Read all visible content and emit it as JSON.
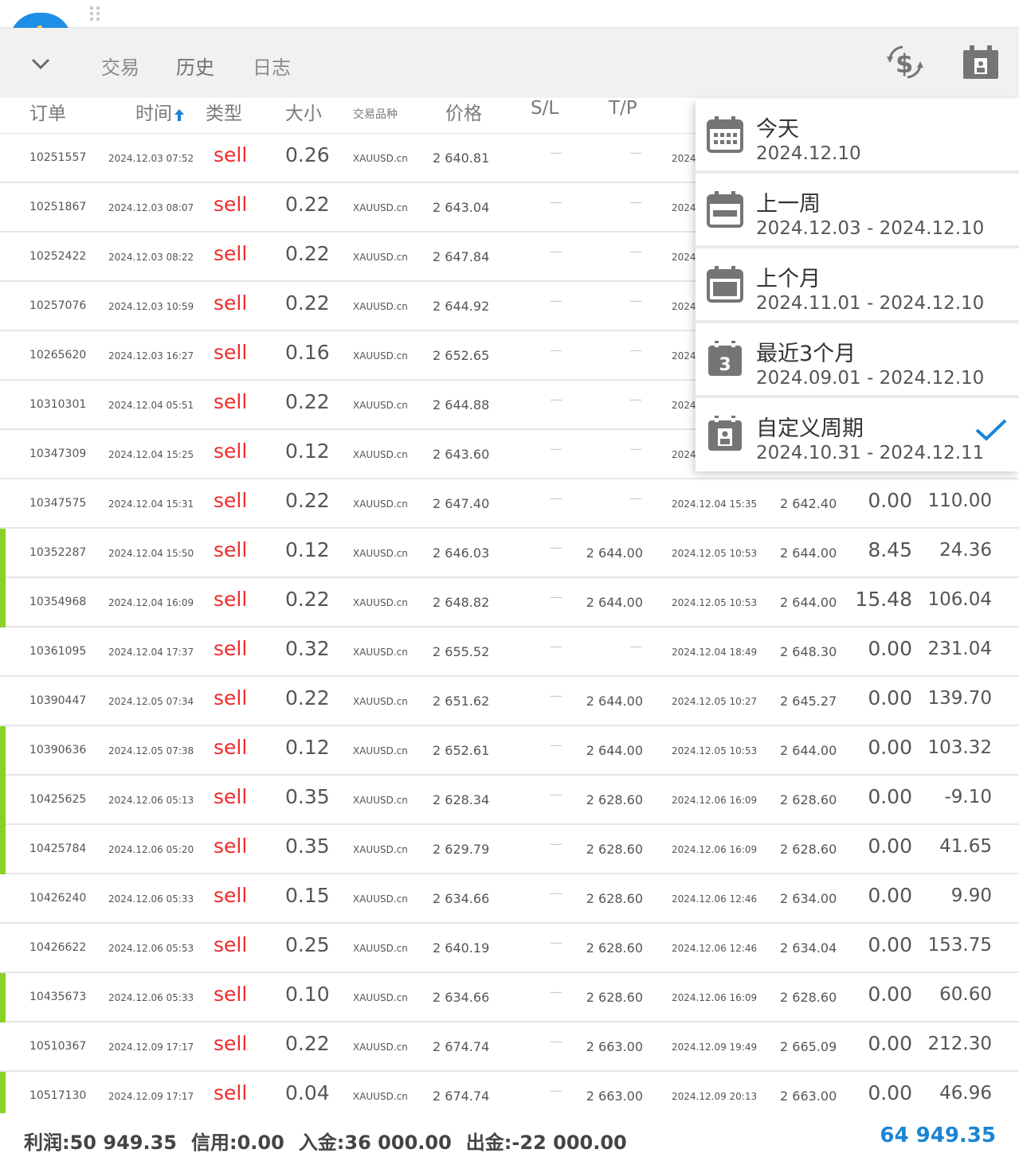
{
  "header": {
    "tabs": [
      {
        "label": "交易"
      },
      {
        "label": "历史"
      },
      {
        "label": "日志"
      }
    ]
  },
  "columns": {
    "order": "订单",
    "time": "时间",
    "type": "类型",
    "size": "大小",
    "symbol": "交易品种",
    "price": "价格",
    "sl": "S/L",
    "tp": "T/P"
  },
  "rows": [
    {
      "order": "10251557",
      "time": "2024.12.03 07:52",
      "type": "sell",
      "size": "0.26",
      "symbol": "XAUUSD.cn",
      "price": "2 640.81",
      "sl": "—",
      "tp": "—",
      "close_time": "2024",
      "close_price": "",
      "swap": "",
      "profit": "",
      "bar": false
    },
    {
      "order": "10251867",
      "time": "2024.12.03 08:07",
      "type": "sell",
      "size": "0.22",
      "symbol": "XAUUSD.cn",
      "price": "2 643.04",
      "sl": "—",
      "tp": "—",
      "close_time": "2024",
      "close_price": "",
      "swap": "",
      "profit": "",
      "bar": false
    },
    {
      "order": "10252422",
      "time": "2024.12.03 08:22",
      "type": "sell",
      "size": "0.22",
      "symbol": "XAUUSD.cn",
      "price": "2 647.84",
      "sl": "—",
      "tp": "—",
      "close_time": "2024",
      "close_price": "",
      "swap": "",
      "profit": "",
      "bar": false
    },
    {
      "order": "10257076",
      "time": "2024.12.03 10:59",
      "type": "sell",
      "size": "0.22",
      "symbol": "XAUUSD.cn",
      "price": "2 644.92",
      "sl": "—",
      "tp": "—",
      "close_time": "2024",
      "close_price": "",
      "swap": "",
      "profit": "",
      "bar": false
    },
    {
      "order": "10265620",
      "time": "2024.12.03 16:27",
      "type": "sell",
      "size": "0.16",
      "symbol": "XAUUSD.cn",
      "price": "2 652.65",
      "sl": "—",
      "tp": "—",
      "close_time": "2024",
      "close_price": "",
      "swap": "",
      "profit": "",
      "bar": false
    },
    {
      "order": "10310301",
      "time": "2024.12.04 05:51",
      "type": "sell",
      "size": "0.22",
      "symbol": "XAUUSD.cn",
      "price": "2 644.88",
      "sl": "—",
      "tp": "—",
      "close_time": "2024",
      "close_price": "",
      "swap": "",
      "profit": "",
      "bar": false
    },
    {
      "order": "10347309",
      "time": "2024.12.04 15:25",
      "type": "sell",
      "size": "0.12",
      "symbol": "XAUUSD.cn",
      "price": "2 643.60",
      "sl": "—",
      "tp": "—",
      "close_time": "2024",
      "close_price": "",
      "swap": "",
      "profit": "",
      "bar": false
    },
    {
      "order": "10347575",
      "time": "2024.12.04 15:31",
      "type": "sell",
      "size": "0.22",
      "symbol": "XAUUSD.cn",
      "price": "2 647.40",
      "sl": "—",
      "tp": "—",
      "close_time": "2024.12.04 15:35",
      "close_price": "2 642.40",
      "swap": "0.00",
      "profit": "110.00",
      "bar": false
    },
    {
      "order": "10352287",
      "time": "2024.12.04 15:50",
      "type": "sell",
      "size": "0.12",
      "symbol": "XAUUSD.cn",
      "price": "2 646.03",
      "sl": "—",
      "tp": "2 644.00",
      "close_time": "2024.12.05 10:53",
      "close_price": "2 644.00",
      "swap": "8.45",
      "profit": "24.36",
      "bar": true
    },
    {
      "order": "10354968",
      "time": "2024.12.04 16:09",
      "type": "sell",
      "size": "0.22",
      "symbol": "XAUUSD.cn",
      "price": "2 648.82",
      "sl": "—",
      "tp": "2 644.00",
      "close_time": "2024.12.05 10:53",
      "close_price": "2 644.00",
      "swap": "15.48",
      "profit": "106.04",
      "bar": true
    },
    {
      "order": "10361095",
      "time": "2024.12.04 17:37",
      "type": "sell",
      "size": "0.32",
      "symbol": "XAUUSD.cn",
      "price": "2 655.52",
      "sl": "—",
      "tp": "—",
      "close_time": "2024.12.04 18:49",
      "close_price": "2 648.30",
      "swap": "0.00",
      "profit": "231.04",
      "bar": false
    },
    {
      "order": "10390447",
      "time": "2024.12.05 07:34",
      "type": "sell",
      "size": "0.22",
      "symbol": "XAUUSD.cn",
      "price": "2 651.62",
      "sl": "—",
      "tp": "2 644.00",
      "close_time": "2024.12.05 10:27",
      "close_price": "2 645.27",
      "swap": "0.00",
      "profit": "139.70",
      "bar": false
    },
    {
      "order": "10390636",
      "time": "2024.12.05 07:38",
      "type": "sell",
      "size": "0.12",
      "symbol": "XAUUSD.cn",
      "price": "2 652.61",
      "sl": "—",
      "tp": "2 644.00",
      "close_time": "2024.12.05 10:53",
      "close_price": "2 644.00",
      "swap": "0.00",
      "profit": "103.32",
      "bar": true
    },
    {
      "order": "10425625",
      "time": "2024.12.06 05:13",
      "type": "sell",
      "size": "0.35",
      "symbol": "XAUUSD.cn",
      "price": "2 628.34",
      "sl": "—",
      "tp": "2 628.60",
      "close_time": "2024.12.06 16:09",
      "close_price": "2 628.60",
      "swap": "0.00",
      "profit": "-9.10",
      "bar": true
    },
    {
      "order": "10425784",
      "time": "2024.12.06 05:20",
      "type": "sell",
      "size": "0.35",
      "symbol": "XAUUSD.cn",
      "price": "2 629.79",
      "sl": "—",
      "tp": "2 628.60",
      "close_time": "2024.12.06 16:09",
      "close_price": "2 628.60",
      "swap": "0.00",
      "profit": "41.65",
      "bar": true
    },
    {
      "order": "10426240",
      "time": "2024.12.06 05:33",
      "type": "sell",
      "size": "0.15",
      "symbol": "XAUUSD.cn",
      "price": "2 634.66",
      "sl": "—",
      "tp": "2 628.60",
      "close_time": "2024.12.06 12:46",
      "close_price": "2 634.00",
      "swap": "0.00",
      "profit": "9.90",
      "bar": false
    },
    {
      "order": "10426622",
      "time": "2024.12.06 05:53",
      "type": "sell",
      "size": "0.25",
      "symbol": "XAUUSD.cn",
      "price": "2 640.19",
      "sl": "—",
      "tp": "2 628.60",
      "close_time": "2024.12.06 12:46",
      "close_price": "2 634.04",
      "swap": "0.00",
      "profit": "153.75",
      "bar": false
    },
    {
      "order": "10435673",
      "time": "2024.12.06 05:33",
      "type": "sell",
      "size": "0.10",
      "symbol": "XAUUSD.cn",
      "price": "2 634.66",
      "sl": "—",
      "tp": "2 628.60",
      "close_time": "2024.12.06 16:09",
      "close_price": "2 628.60",
      "swap": "0.00",
      "profit": "60.60",
      "bar": true
    },
    {
      "order": "10510367",
      "time": "2024.12.09 17:17",
      "type": "sell",
      "size": "0.22",
      "symbol": "XAUUSD.cn",
      "price": "2 674.74",
      "sl": "—",
      "tp": "2 663.00",
      "close_time": "2024.12.09 19:49",
      "close_price": "2 665.09",
      "swap": "0.00",
      "profit": "212.30",
      "bar": false
    },
    {
      "order": "10517130",
      "time": "2024.12.09 17:17",
      "type": "sell",
      "size": "0.04",
      "symbol": "XAUUSD.cn",
      "price": "2 674.74",
      "sl": "—",
      "tp": "2 663.00",
      "close_time": "2024.12.09 20:13",
      "close_price": "2 663.00",
      "swap": "0.00",
      "profit": "46.96",
      "bar": true
    }
  ],
  "footer": {
    "profit_label": "利润:",
    "profit_value": "50 949.35",
    "credit_label": "信用:",
    "credit_value": "0.00",
    "deposit_label": "入金:",
    "deposit_value": "36 000.00",
    "withdraw_label": "出金:",
    "withdraw_value": "-22 000.00",
    "balance": "64 949.35"
  },
  "period_menu": {
    "items": [
      {
        "title": "今天",
        "range": "2024.12.10",
        "icon": "calendar-day-icon",
        "selected": false
      },
      {
        "title": "上一周",
        "range": "2024.12.03 - 2024.12.10",
        "icon": "calendar-week-icon",
        "selected": false
      },
      {
        "title": "上个月",
        "range": "2024.11.01 - 2024.12.10",
        "icon": "calendar-month-icon",
        "selected": false
      },
      {
        "title": "最近3个月",
        "range": "2024.09.01 - 2024.12.10",
        "icon": "calendar-3-icon",
        "badge": "3",
        "selected": false
      },
      {
        "title": "自定义周期",
        "range": "2024.10.31 - 2024.12.11",
        "icon": "calendar-custom-icon",
        "selected": true
      }
    ]
  },
  "colors": {
    "sell": "#ee2c2c",
    "accent": "#1a85d4",
    "bar": "#8ad126",
    "icon_gray": "#757575"
  }
}
